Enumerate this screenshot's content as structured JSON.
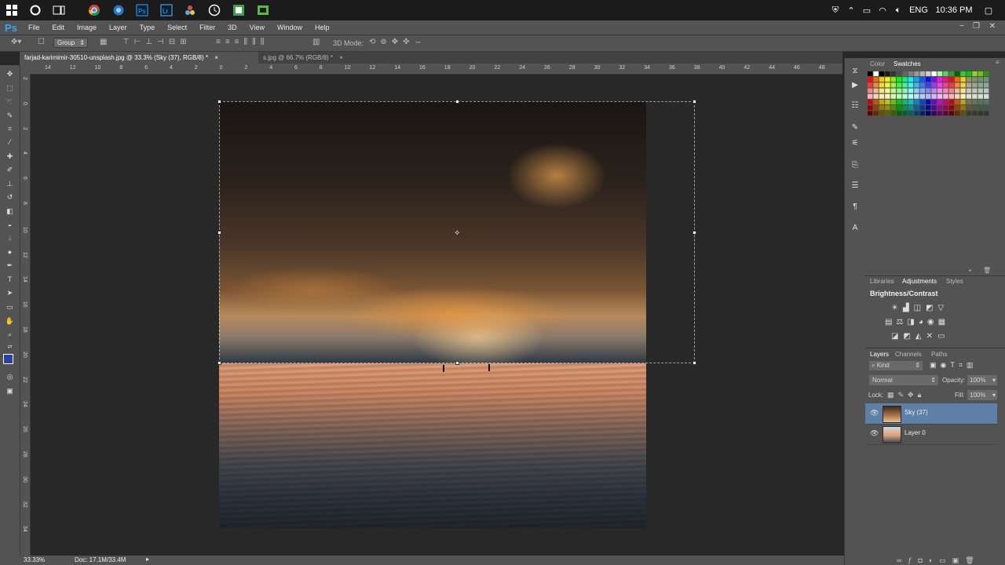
{
  "taskbar": {
    "lang": "ENG",
    "time": "10:36 PM",
    "icons": [
      "windows-icon",
      "cortana-icon",
      "task-view-icon",
      "chrome-icon",
      "app-icon",
      "photoshop-icon",
      "lightroom-icon",
      "resolve-icon",
      "clock-app-icon",
      "green-app-icon",
      "camtasia-icon"
    ]
  },
  "menubar": {
    "logo": "Ps",
    "items": [
      "File",
      "Edit",
      "Image",
      "Layer",
      "Type",
      "Select",
      "Filter",
      "3D",
      "View",
      "Window",
      "Help"
    ]
  },
  "options": {
    "group_select": "Group",
    "mode_3d": "3D Mode:"
  },
  "doctabs": [
    {
      "label": "farjad-karimimir-30510-unsplash.jpg @ 33.3% (Sky (37), RGB/8) *",
      "close": "×"
    },
    {
      "label": "s.jpg @ 66.7% (RGB/8) *",
      "close": "×"
    }
  ],
  "ruler_h": [
    "14",
    "12",
    "10",
    "8",
    "6",
    "4",
    "2",
    "0",
    "2",
    "4",
    "6",
    "8",
    "10",
    "12",
    "14",
    "16",
    "18",
    "20",
    "22",
    "24",
    "26",
    "28",
    "30",
    "32",
    "34",
    "36",
    "38",
    "40",
    "42",
    "44",
    "46",
    "48"
  ],
  "ruler_v": [
    "2",
    "0",
    "2",
    "4",
    "6",
    "8",
    "1\n0",
    "1\n2",
    "1\n4",
    "1\n6",
    "1\n8",
    "2\n0",
    "2\n2",
    "2\n4",
    "2\n6",
    "2\n8",
    "3\n0",
    "3\n2",
    "3\n4"
  ],
  "color_panel": {
    "tab_color": "Color",
    "tab_swatches": "Swatches"
  },
  "adjust_panel": {
    "tab_libraries": "Libraries",
    "tab_adjustments": "Adjustments",
    "tab_styles": "Styles",
    "title": "Brightness/Contrast"
  },
  "layers_panel": {
    "tab_layers": "Layers",
    "tab_channels": "Channels",
    "tab_paths": "Paths",
    "kind": "Kind",
    "blend_mode": "Normal",
    "opacity_label": "Opacity:",
    "opacity_value": "100%",
    "lock_label": "Lock:",
    "fill_label": "Fill:",
    "fill_value": "100%",
    "layers": [
      {
        "name": "Sky (37)",
        "selected": true
      },
      {
        "name": "Layer 0",
        "selected": false
      }
    ]
  },
  "status": {
    "zoom": "33.33%",
    "doc": "Doc: 17.1M/33.4M"
  },
  "colors": {
    "accent": "#31a8ff",
    "selected_layer": "#5e7fa6",
    "panel": "#535353",
    "canvas": "#282828"
  }
}
